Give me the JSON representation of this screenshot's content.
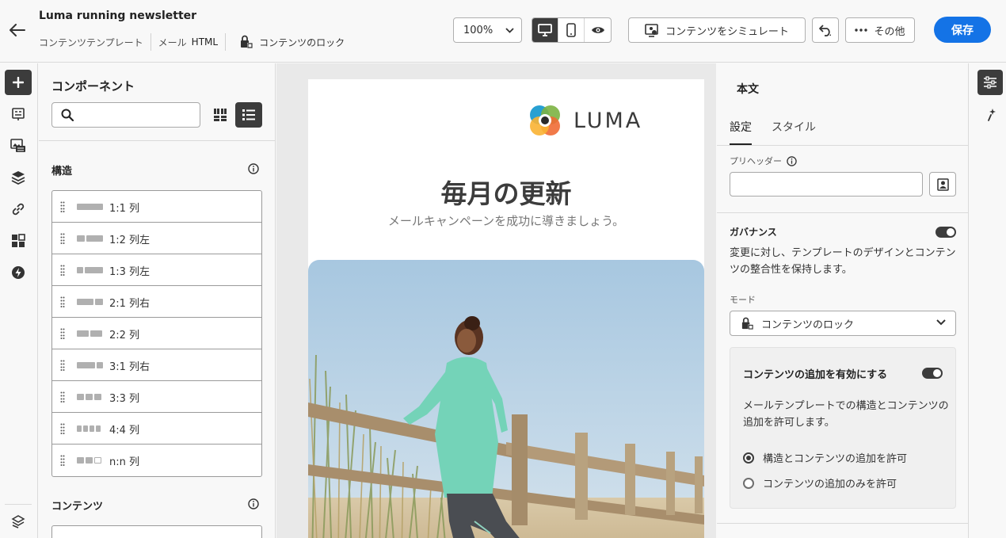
{
  "header": {
    "title": "Luma running newsletter",
    "breadcrumb_template": "コンテンツテンプレート",
    "breadcrumb_email": "メール",
    "breadcrumb_html": "HTML",
    "lock_label": "コンテンツのロック",
    "zoom_value": "100%",
    "simulate_label": "コンテンツをシミュレート",
    "more_label": "その他",
    "save_label": "保存"
  },
  "left_panel": {
    "title": "コンポーネント",
    "search_placeholder": "",
    "structure_heading": "構造",
    "structure_items": [
      {
        "label": "1:1 列"
      },
      {
        "label": "1:2 列左"
      },
      {
        "label": "1:3 列左"
      },
      {
        "label": "2:1 列右"
      },
      {
        "label": "2:2 列"
      },
      {
        "label": "3:1 列右"
      },
      {
        "label": "3:3 列"
      },
      {
        "label": "4:4 列"
      },
      {
        "label": "n:n 列"
      }
    ],
    "content_heading": "コンテンツ"
  },
  "email": {
    "logo_text": "LUMA",
    "headline": "毎月の更新",
    "subline": "メールキャンペーンを成功に導きましょう。"
  },
  "right_panel": {
    "title": "本文",
    "tab_settings": "設定",
    "tab_style": "スタイル",
    "preheader_label": "プリヘッダー",
    "preheader_value": "",
    "governance_title": "ガバナンス",
    "governance_desc": "変更に対し、テンプレートのデザインとコンテンツの整合性を保持します。",
    "mode_label": "モード",
    "mode_value": "コンテンツのロック",
    "enable_add_title": "コンテンツの追加を有効にする",
    "enable_add_desc": "メールテンプレートでの構造とコンテンツの追加を許可します。",
    "radio_structure": "構造とコンテンツの追加を許可",
    "radio_content_only": "コンテンツの追加のみを許可"
  },
  "colors": {
    "accent": "#1473e6",
    "dark": "#3c3c3c"
  }
}
